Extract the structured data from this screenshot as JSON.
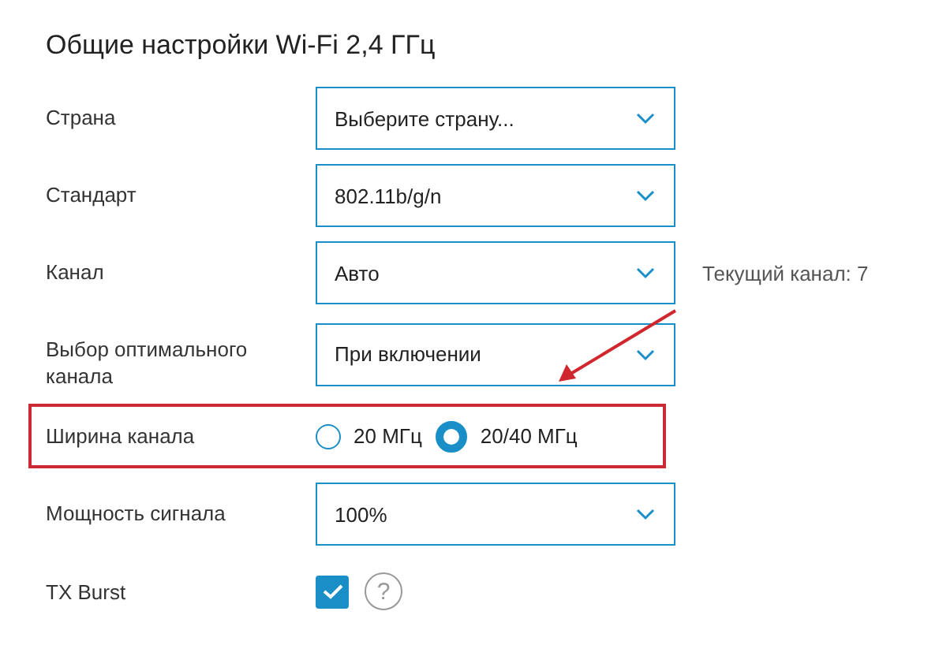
{
  "title": "Общие настройки Wi-Fi 2,4 ГГц",
  "rows": [
    {
      "kind": "select",
      "label": "Страна",
      "value": "Выберите страну...",
      "highlighted": false
    },
    {
      "kind": "select",
      "label": "Стандарт",
      "value": "802.11b/g/n",
      "highlighted": false
    },
    {
      "kind": "select",
      "label": "Канал",
      "value": "Авто",
      "note": "Текущий канал: 7",
      "highlighted": false
    },
    {
      "kind": "select",
      "label": "Выбор оптимального канала",
      "value": "При включении",
      "highlighted": false
    },
    {
      "kind": "radio",
      "label": "Ширина канала",
      "highlighted": true,
      "options": [
        {
          "label": "20 МГц",
          "selected": false
        },
        {
          "label": "20/40 МГц",
          "selected": true
        }
      ]
    },
    {
      "kind": "select",
      "label": "Мощность сигнала",
      "value": "100%",
      "highlighted": false
    },
    {
      "kind": "checkbox",
      "label": "TX Burst",
      "checked": true,
      "help": "?",
      "highlighted": false
    }
  ],
  "annotation": {
    "kind": "arrow"
  }
}
